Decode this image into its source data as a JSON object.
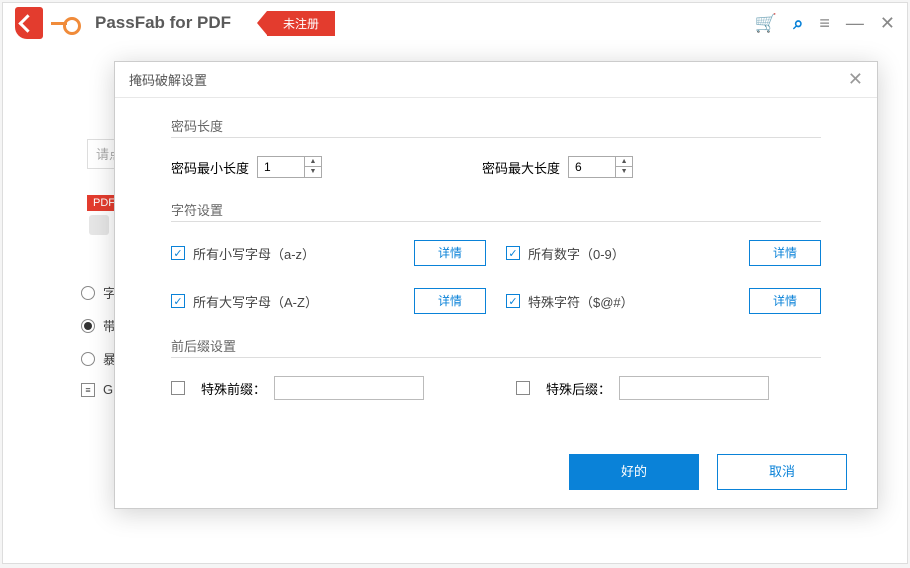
{
  "app": {
    "title": "PassFab for PDF",
    "unregistered_badge": "未注册"
  },
  "bg": {
    "placeholder_hint": "请点",
    "pdf_tag": "PDF",
    "radios": {
      "r1": "字",
      "r2": "带",
      "r3": "暴",
      "gp": "GF"
    }
  },
  "dialog": {
    "title": "掩码破解设置",
    "length_section": {
      "legend": "密码长度",
      "min_label": "密码最小长度",
      "min_value": "1",
      "max_label": "密码最大长度",
      "max_value": "6"
    },
    "charset_section": {
      "legend": "字符设置",
      "lowercase": "所有小写字母（a-z）",
      "uppercase": "所有大写字母（A-Z）",
      "digits": "所有数字（0-9）",
      "special": "特殊字符（$@#）",
      "detail_btn": "详情"
    },
    "affix_section": {
      "legend": "前后缀设置",
      "prefix_label": "特殊前缀：",
      "suffix_label": "特殊后缀："
    },
    "buttons": {
      "ok": "好的",
      "cancel": "取消"
    }
  }
}
